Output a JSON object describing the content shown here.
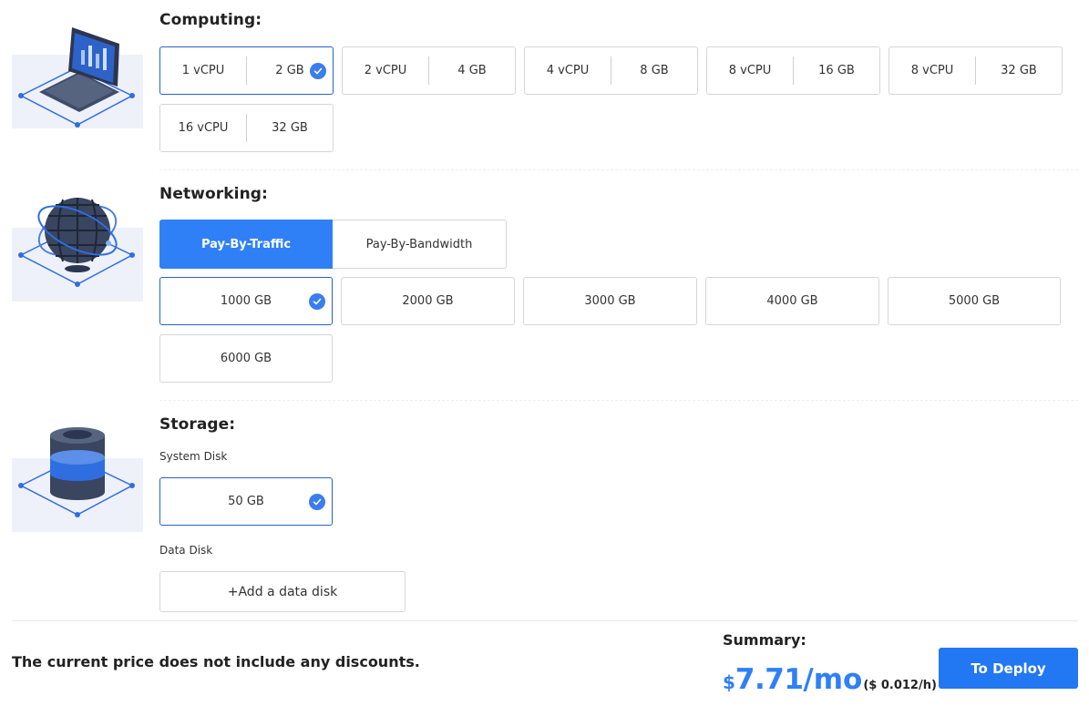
{
  "computing": {
    "title": "Computing:",
    "options": [
      {
        "cpu": "1 vCPU",
        "ram": "2 GB",
        "selected": true
      },
      {
        "cpu": "2 vCPU",
        "ram": "4 GB",
        "selected": false
      },
      {
        "cpu": "4 vCPU",
        "ram": "8 GB",
        "selected": false
      },
      {
        "cpu": "8 vCPU",
        "ram": "16 GB",
        "selected": false
      },
      {
        "cpu": "8 vCPU",
        "ram": "32 GB",
        "selected": false
      },
      {
        "cpu": "16 vCPU",
        "ram": "32 GB",
        "selected": false
      }
    ]
  },
  "networking": {
    "title": "Networking:",
    "tabs": [
      {
        "label": "Pay-By-Traffic",
        "active": true
      },
      {
        "label": "Pay-By-Bandwidth",
        "active": false
      }
    ],
    "options": [
      {
        "label": "1000 GB",
        "selected": true
      },
      {
        "label": "2000 GB",
        "selected": false
      },
      {
        "label": "3000 GB",
        "selected": false
      },
      {
        "label": "4000 GB",
        "selected": false
      },
      {
        "label": "5000 GB",
        "selected": false
      },
      {
        "label": "6000 GB",
        "selected": false
      }
    ]
  },
  "storage": {
    "title": "Storage:",
    "system_disk_label": "System Disk",
    "system_disk": {
      "label": "50 GB",
      "selected": true
    },
    "data_disk_label": "Data Disk",
    "add_data_disk": "+Add a data disk"
  },
  "footer": {
    "discount_note": "The current price does not include any discounts.",
    "summary_label": "Summary:",
    "currency": "$",
    "price": "7.71",
    "period": "/mo",
    "hourly": "($ 0.012/h)",
    "deploy_label": "To Deploy"
  },
  "colors": {
    "accent": "#2f80f6",
    "check": "#3a7df0",
    "selected_border": "#2a62c9"
  },
  "icons": [
    "laptop-illustration",
    "globe-illustration",
    "database-illustration",
    "check-icon"
  ]
}
